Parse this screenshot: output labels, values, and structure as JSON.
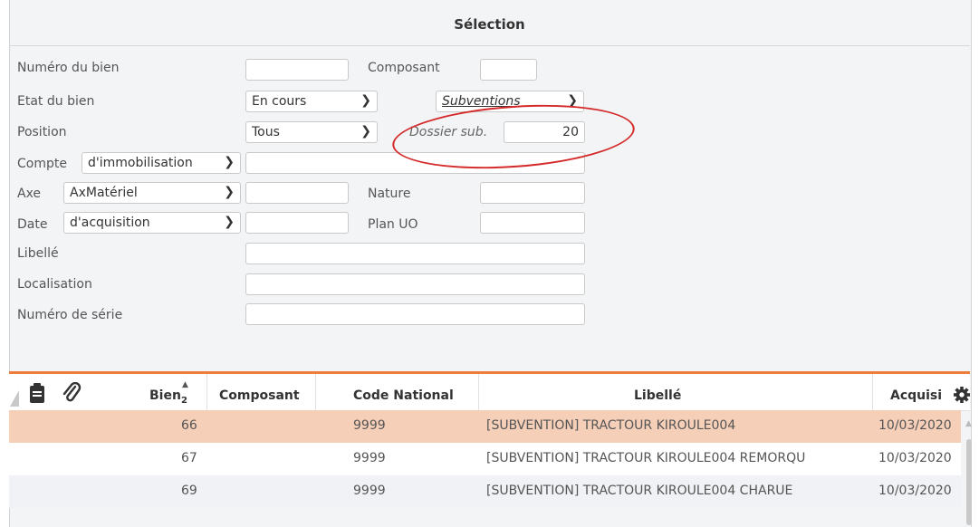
{
  "section": {
    "title": "Sélection"
  },
  "form": {
    "numero_bien": {
      "label": "Numéro du bien",
      "value": ""
    },
    "composant": {
      "label": "Composant",
      "value": ""
    },
    "etat_bien": {
      "label": "Etat du bien",
      "value": "En cours"
    },
    "subventions": {
      "value": "Subventions"
    },
    "position": {
      "label": "Position",
      "value": "Tous"
    },
    "dossier_sub": {
      "label": "Dossier sub.",
      "value": "20"
    },
    "compte": {
      "label": "Compte",
      "type": "d'immobilisation",
      "value": ""
    },
    "axe": {
      "label": "Axe",
      "type": "AxMatériel",
      "value": ""
    },
    "nature": {
      "label": "Nature",
      "value": ""
    },
    "date": {
      "label": "Date",
      "type": "d'acquisition",
      "value": ""
    },
    "plan_uo": {
      "label": "Plan UO",
      "value": ""
    },
    "libelle": {
      "label": "Libellé",
      "value": ""
    },
    "localisation": {
      "label": "Localisation",
      "value": ""
    },
    "numero_serie": {
      "label": "Numéro de série",
      "value": ""
    }
  },
  "table": {
    "headers": {
      "bien": "Bien",
      "bien_sort": "2",
      "composant": "Composant",
      "code_national": "Code National",
      "libelle": "Libellé",
      "acquisition": "Acquisi"
    },
    "rows": [
      {
        "bien": "66",
        "composant": "",
        "code": "9999",
        "libelle": "[SUBVENTION] TRACTOUR KIROULE004",
        "date": "10/03/2020"
      },
      {
        "bien": "67",
        "composant": "",
        "code": "9999",
        "libelle": "[SUBVENTION] TRACTOUR KIROULE004 REMORQU",
        "date": "10/03/2020"
      },
      {
        "bien": "69",
        "composant": "",
        "code": "9999",
        "libelle": "[SUBVENTION] TRACTOUR KIROULE004 CHARUE",
        "date": "10/03/2020"
      }
    ]
  },
  "colors": {
    "accent": "#ee7d3b",
    "selected_row": "#f6cfb9",
    "alt_row": "#f1f2f5",
    "annotation": "#d42a2a"
  }
}
